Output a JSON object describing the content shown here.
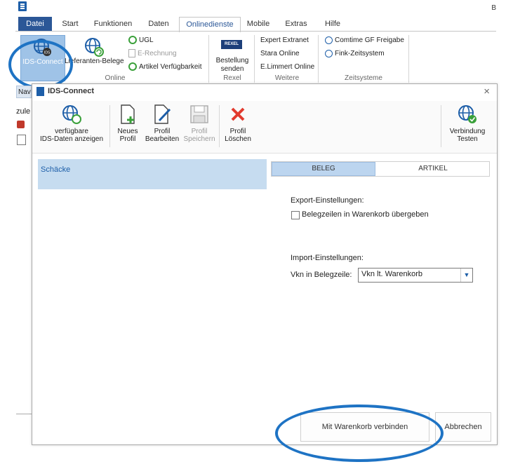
{
  "titlebar": {
    "corner_letter": "B"
  },
  "ribbon": {
    "tabs": [
      "Datei",
      "Start",
      "Funktionen",
      "Daten",
      "Onlinedienste",
      "Mobile",
      "Extras",
      "Hilfe"
    ],
    "active_tab": "Onlinedienste",
    "online": {
      "ids_connect": "IDS-Connect",
      "lieferanten": "Lieferanten-Belege",
      "ugl": "UGL",
      "erechnung": "E-Rechnung",
      "artikel": "Artikel Verfügbarkeit",
      "label": "Online"
    },
    "rexel": {
      "logo": "REXEL",
      "bestellung_1": "Bestellung",
      "bestellung_2": "senden",
      "label": "Rexel"
    },
    "weitere": {
      "items": [
        "Expert Extranet",
        "Stara Online",
        "E.Limmert Online"
      ],
      "label": "Weitere"
    },
    "zeitsysteme": {
      "items": [
        "Comtime GF Freigabe",
        "Fink-Zeitsystem"
      ],
      "label": "Zeitsysteme"
    }
  },
  "sidebar_fragments": {
    "nav": "Nav",
    "zule": "zule"
  },
  "dialog": {
    "title": "IDS-Connect",
    "close": "×",
    "toolbar": {
      "verfuegbar_1": "verfügbare",
      "verfuegbar_2": "IDS-Daten anzeigen",
      "neues_1": "Neues",
      "neues_2": "Profil",
      "bearbeiten_1": "Profil",
      "bearbeiten_2": "Bearbeiten",
      "speichern_1": "Profil",
      "speichern_2": "Speichern",
      "loeschen_1": "Profil",
      "loeschen_2": "Löschen",
      "verbindung_1": "Verbindung",
      "verbindung_2": "Testen"
    },
    "profiles": [
      "Schäcke"
    ],
    "tabs": {
      "beleg": "BELEG",
      "artikel": "ARTIKEL"
    },
    "export_heading": "Export-Einstellungen:",
    "export_checkbox": "Belegzeilen in Warenkorb übergeben",
    "import_heading": "Import-Einstellungen:",
    "vkn_label": "Vkn in Belegzeile:",
    "vkn_value": "Vkn lt. Warenkorb",
    "connect_button": "Mit Warenkorb verbinden",
    "cancel_button": "Abbrechen"
  },
  "colors": {
    "accent": "#2b5797",
    "highlight": "#1e73c4",
    "selection": "#c6dcf0",
    "delete_red": "#e23b2e"
  }
}
